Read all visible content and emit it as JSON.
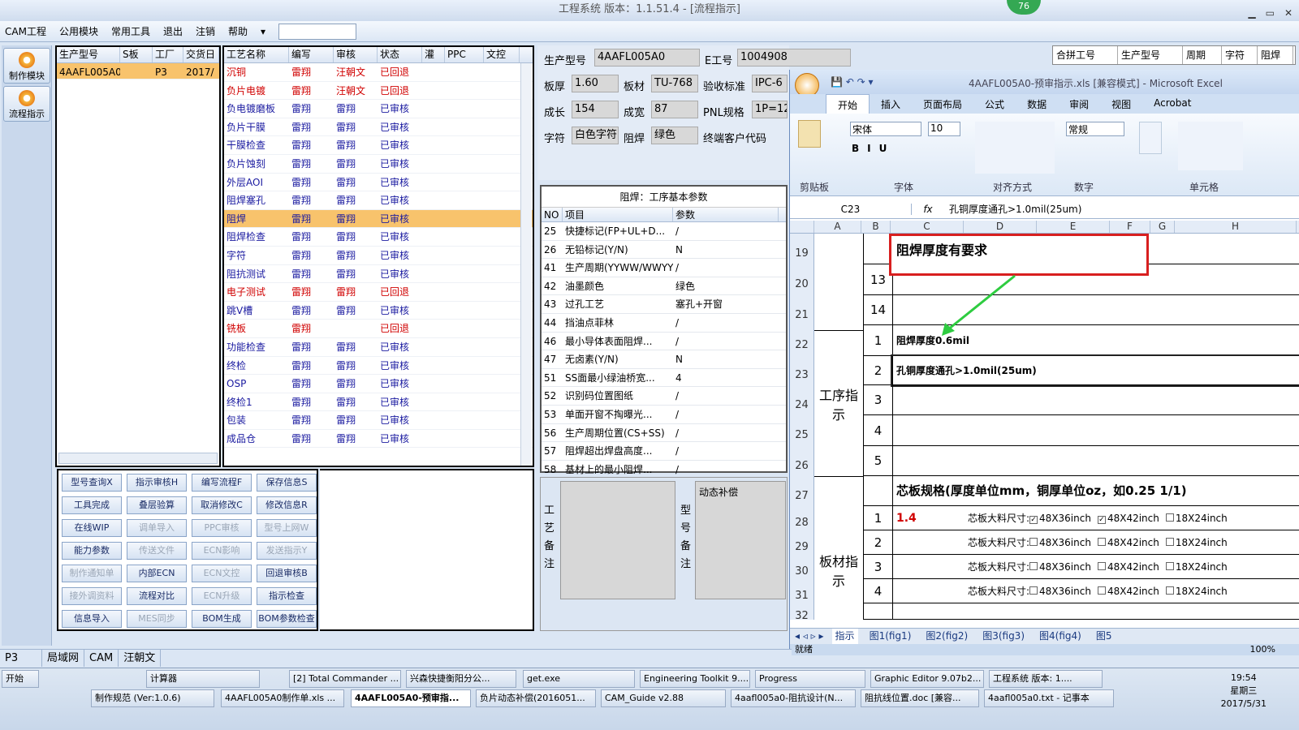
{
  "window": {
    "title": "工程系统  版本：1.1.51.4 - [流程指示]",
    "badge": "76"
  },
  "menu": [
    "CAM工程",
    "公用模块",
    "常用工具",
    "退出",
    "注销",
    "帮助"
  ],
  "left_tools": [
    {
      "label": "制作模块"
    },
    {
      "label": "流程指示"
    }
  ],
  "orders": {
    "headers": [
      "生产型号",
      "S板",
      "工厂",
      "交货日"
    ],
    "row": [
      "4AAFL005A0",
      "",
      "P3",
      "2017/"
    ]
  },
  "process": {
    "headers": [
      "工艺名称",
      "编写",
      "审核",
      "状态",
      "灌",
      "PPC",
      "文控"
    ],
    "rows": [
      [
        "沉铜",
        "雷翔",
        "汪朝文",
        "已回退"
      ],
      [
        "负片电镀",
        "雷翔",
        "汪朝文",
        "已回退"
      ],
      [
        "负电镀磨板",
        "雷翔",
        "雷翔",
        "已审核"
      ],
      [
        "负片干膜",
        "雷翔",
        "雷翔",
        "已审核"
      ],
      [
        "干膜检查",
        "雷翔",
        "雷翔",
        "已审核"
      ],
      [
        "负片蚀刻",
        "雷翔",
        "雷翔",
        "已审核"
      ],
      [
        "外层AOI",
        "雷翔",
        "雷翔",
        "已审核"
      ],
      [
        "阻焊塞孔",
        "雷翔",
        "雷翔",
        "已审核"
      ],
      [
        "阻焊",
        "雷翔",
        "雷翔",
        "已审核"
      ],
      [
        "阻焊检查",
        "雷翔",
        "雷翔",
        "已审核"
      ],
      [
        "字符",
        "雷翔",
        "雷翔",
        "已审核"
      ],
      [
        "阻抗测试",
        "雷翔",
        "雷翔",
        "已审核"
      ],
      [
        "电子测试",
        "雷翔",
        "雷翔",
        "已回退"
      ],
      [
        "跳V槽",
        "雷翔",
        "雷翔",
        "已审核"
      ],
      [
        "铣板",
        "雷翔",
        "",
        "已回退"
      ],
      [
        "功能检查",
        "雷翔",
        "雷翔",
        "已审核"
      ],
      [
        "终检",
        "雷翔",
        "雷翔",
        "已审核"
      ],
      [
        "OSP",
        "雷翔",
        "雷翔",
        "已审核"
      ],
      [
        "终检1",
        "雷翔",
        "雷翔",
        "已审核"
      ],
      [
        "包装",
        "雷翔",
        "雷翔",
        "已审核"
      ],
      [
        "成品仓",
        "雷翔",
        "雷翔",
        "已审核"
      ]
    ]
  },
  "buttons": [
    "型号查询X",
    "指示审核H",
    "编写流程F",
    "保存信息S",
    "工具完成",
    "叠层验算",
    "取消修改C",
    "修改信息R",
    "在线WIP",
    "调单导入",
    "PPC审核",
    "型号上网W",
    "能力参数",
    "传送文件",
    "ECN影响",
    "发送指示Y",
    "制作通知单",
    "内部ECN",
    "ECN文控",
    "回退审核B",
    "接外调资料",
    "流程对比",
    "ECN升级",
    "指示检查",
    "信息导入",
    "MES同步",
    "BOM生成",
    "BOM参数检查"
  ],
  "disabled_buttons": [
    9,
    10,
    11,
    13,
    14,
    15,
    16,
    18,
    20,
    22,
    25
  ],
  "form": {
    "model_label": "生产型号",
    "model": "4AAFL005A0",
    "e_label": "E工号",
    "e_no": "1004908",
    "thick_label": "板厚",
    "thick": "1.60",
    "mat_label": "板材",
    "mat": "TU-768",
    "std_label": "验收标准",
    "std": "IPC-6",
    "len_label": "成长",
    "len": "154",
    "wid_label": "成宽",
    "wid": "87",
    "pnl_label": "PNL规格",
    "pnl": "1P=12",
    "char_label": "字符",
    "char": "白色字符",
    "mask_label": "阻焊",
    "mask": "绿色",
    "cust_label": "终端客户代码"
  },
  "right_headers": [
    "合拼工号",
    "生产型号",
    "周期",
    "字符",
    "阻焊"
  ],
  "params": {
    "title": "阻焊：工序基本参数",
    "headers": [
      "NO",
      "项目",
      "参数"
    ],
    "rows": [
      [
        "25",
        "快捷标记(FP+UL+D...",
        "/"
      ],
      [
        "26",
        "无铅标记(Y/N)",
        "N"
      ],
      [
        "41",
        "生产周期(YYWW/WWYY)",
        "/"
      ],
      [
        "42",
        "油墨颜色",
        "绿色"
      ],
      [
        "43",
        "过孔工艺",
        "塞孔+开窗"
      ],
      [
        "44",
        "挡油点菲林",
        "/"
      ],
      [
        "46",
        "最小导体表面阻焊...",
        "/"
      ],
      [
        "47",
        "无卤素(Y/N)",
        "N"
      ],
      [
        "51",
        "SS面最小绿油桥宽...",
        "4"
      ],
      [
        "52",
        "识别码位置图纸",
        "/"
      ],
      [
        "53",
        "单面开窗不掏曝光...",
        "/"
      ],
      [
        "56",
        "生产周期位置(CS+SS)",
        "/"
      ],
      [
        "57",
        "阻焊超出焊盘高度...",
        "/"
      ],
      [
        "58",
        "基材上的最小阻焊...",
        "/"
      ]
    ]
  },
  "remarks": {
    "process": "工艺备注",
    "model": "型号备注",
    "dyn": "动态补偿"
  },
  "excel": {
    "title": "4AAFL005A0-预审指示.xls [兼容模式] - Microsoft Excel",
    "tabs": [
      "开始",
      "插入",
      "页面布局",
      "公式",
      "数据",
      "审阅",
      "视图",
      "Acrobat"
    ],
    "font": "宋体",
    "size": "10",
    "numfmt": "常规",
    "groups": [
      "剪贴板",
      "字体",
      "对齐方式",
      "数字",
      "单元格"
    ],
    "cell_ref": "C23",
    "formula": "孔铜厚度通孔>1.0mil(25um)",
    "cols": [
      "A",
      "B",
      "C",
      "D",
      "E",
      "F",
      "G",
      "H"
    ],
    "note": "阻焊厚度有要求",
    "sec1": "工序指示",
    "sec2": "板材指示",
    "rows": [
      [
        "19",
        ""
      ],
      [
        "20",
        "13"
      ],
      [
        "21",
        "14"
      ],
      [
        "22",
        "1"
      ],
      [
        "23",
        "2"
      ],
      [
        "24",
        "3"
      ],
      [
        "25",
        "4"
      ],
      [
        "26",
        "5"
      ],
      [
        "27",
        ""
      ],
      [
        "28",
        "1"
      ],
      [
        "29",
        "2"
      ],
      [
        "30",
        "3"
      ],
      [
        "31",
        "4"
      ],
      [
        "32",
        ""
      ]
    ],
    "r22": "阻焊厚度0.6mil",
    "r23": "孔铜厚度通孔>1.0mil(25um)",
    "core": "芯板规格(厚度单位mm，铜厚单位oz，如0.25 1/1)",
    "core_val": "1.4",
    "core_lbl": "芯板大料尺寸:",
    "sizes": [
      "48X36inch",
      "48X42inch",
      "18X24inch"
    ],
    "sheets": [
      "指示",
      "图1(fig1)",
      "图2(fig2)",
      "图3(fig3)",
      "图4(fig4)",
      "图5"
    ],
    "status": "就绪",
    "zoom": "100%"
  },
  "bottom": [
    "P3",
    "局域网",
    "CAM",
    "汪朝文"
  ],
  "taskbar": {
    "start": "开始",
    "row1": [
      "计算器",
      "[2] Total Commander ...",
      "兴森快捷衡阳分公...",
      "get.exe",
      "Engineering Toolkit 9....",
      "Progress",
      "Graphic Editor 9.07b2...",
      "工程系统  版本: 1...."
    ],
    "row2": [
      "制作规范 (Ver:1.0.6)",
      "4AAFL005A0制作单.xls ...",
      "4AAFL005A0-预审指...",
      "负片动态补偿(2016051...",
      "CAM_Guide v2.88",
      "4aafl005a0-阻抗设计(N...",
      "阻抗线位置.doc [兼容...",
      "4aafl005a0.txt - 记事本"
    ],
    "time": "19:54",
    "day": "星期三",
    "date": "2017/5/31"
  }
}
